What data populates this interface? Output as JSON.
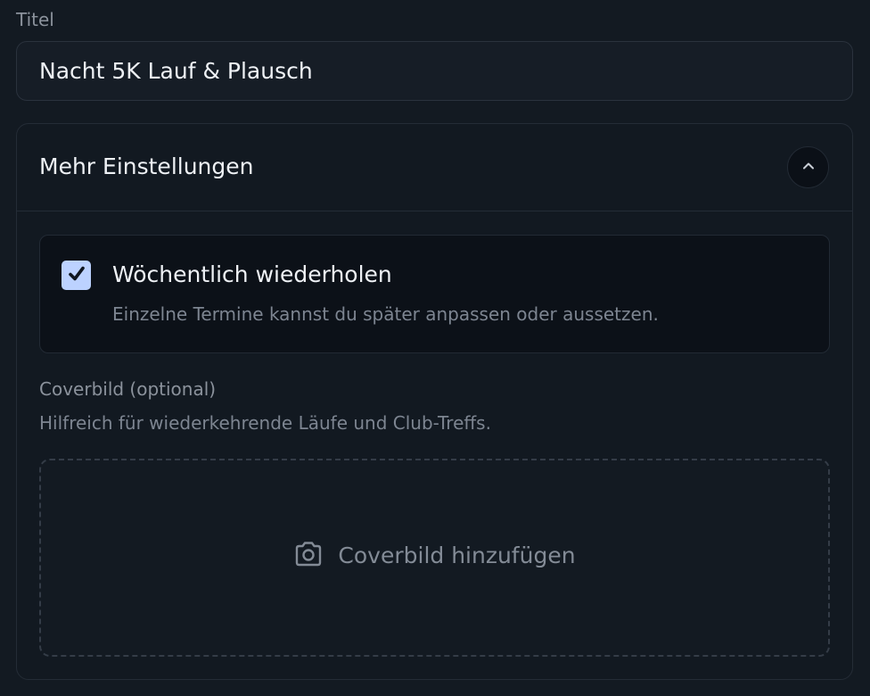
{
  "title_field": {
    "label": "Titel",
    "value": "Nacht 5K Lauf & Plausch"
  },
  "more_settings": {
    "title": "Mehr Einstellungen",
    "expanded": true,
    "toggle_icon": "chevron-up-icon"
  },
  "repeat_weekly": {
    "checked": true,
    "title": "Wöchentlich wiederholen",
    "description": "Einzelne Termine kannst du später anpassen oder aussetzen."
  },
  "cover": {
    "label": "Coverbild (optional)",
    "hint": "Hilfreich für wiederkehrende Läufe und Club-Treffs.",
    "add_label": "Coverbild hinzufügen",
    "icon": "camera-icon"
  },
  "colors": {
    "background": "#131a22",
    "checkbox_fill": "#bcd2ff",
    "text_primary": "#eef1f5",
    "text_muted": "#7d8591"
  }
}
